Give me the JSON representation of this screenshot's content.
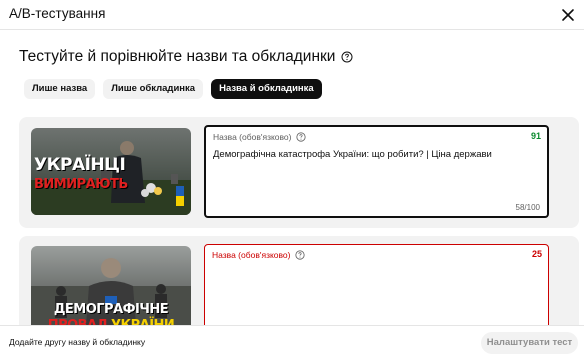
{
  "dialog": {
    "title": "А/В-тестування"
  },
  "main": {
    "headline": "Тестуйте й порівнюйте назви та обкладинки"
  },
  "tabs": [
    {
      "label": "Лише назва",
      "active": false
    },
    {
      "label": "Лише обкладинка",
      "active": false
    },
    {
      "label": "Назва й обкладинка",
      "active": true
    }
  ],
  "variants": [
    {
      "field_label": "Назва (обов'язково)",
      "score": "91",
      "title_value": "Демографічна катастрофа України: що робити? | Ціна держави",
      "counter": "58/100",
      "thumbnail": {
        "line1": "УКРАЇНЦІ",
        "line2": "ВИМИРАЮТЬ"
      }
    },
    {
      "field_label": "Назва (обов'язково)",
      "score": "25",
      "title_value": "",
      "thumbnail": {
        "line1": "ДЕМОГРАФІЧНЕ",
        "line2": "ПРОВАЛ",
        "line3": "УКРАЇНИ"
      }
    }
  ],
  "footer": {
    "add_link": "Додайте другу назву й обкладинку",
    "submit_button": "Налаштувати тест"
  },
  "colors": {
    "accent_dark": "#0f0f0f",
    "score_good": "#0a8a2e",
    "score_bad": "#cc0000"
  }
}
